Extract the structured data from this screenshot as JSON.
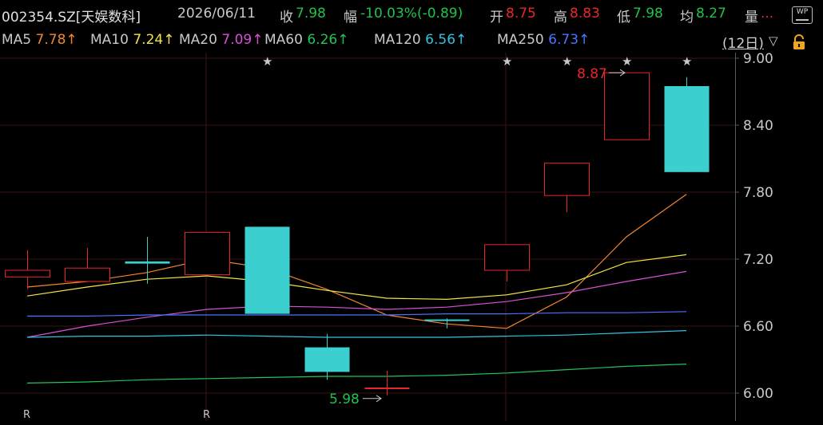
{
  "header": {
    "code": "002354.SZ[天娱数科]",
    "date": "2026/06/11",
    "close_label": "收",
    "close_value": "7.98",
    "change_label": "幅",
    "change_value": "-10.03%(-0.89)",
    "open_label": "开",
    "open_value": "8.75",
    "high_label": "高",
    "high_value": "8.83",
    "low_label": "低",
    "low_value": "7.98",
    "avg_label": "均",
    "avg_value": "8.27",
    "volume_label": "量",
    "volume_value": "..."
  },
  "wp_button": {
    "label": "WP"
  },
  "ma_legend": [
    {
      "label": "MA5",
      "value": "7.78↑",
      "color": "#f2862e"
    },
    {
      "label": "MA10",
      "value": "7.24↑",
      "color": "#f1e545"
    },
    {
      "label": "MA20",
      "value": "7.09↑",
      "color": "#d84fd8"
    },
    {
      "label": "MA60",
      "value": "6.26↑",
      "color": "#22c35a"
    },
    {
      "label": "MA120",
      "value": "6.56↑",
      "color": "#31c3e0"
    },
    {
      "label": "MA250",
      "value": "6.73↑",
      "color": "#4a73ff"
    }
  ],
  "period_label": "(12日)",
  "period_arrow": "▽",
  "icons": {
    "lock": "lock-icon",
    "period_dropdown": "chevron-down-icon"
  },
  "colors": {
    "up": "#e8262b",
    "down": "#3ccfcf",
    "grid": "#3a1616",
    "axis": "#5a5a5a",
    "text": "#c8c8c8"
  },
  "chart_data": {
    "type": "candlestick",
    "y_ticks": [
      "9.00",
      "8.40",
      "7.80",
      "7.20",
      "6.60",
      "6.00"
    ],
    "ylim": [
      5.75,
      9.05
    ],
    "candles": [
      {
        "open": 7.04,
        "close": 7.1,
        "high": 7.28,
        "low": 6.93
      },
      {
        "open": 7.0,
        "close": 7.12,
        "high": 7.3,
        "low": 7.0
      },
      {
        "open": 7.18,
        "close": 7.16,
        "high": 7.4,
        "low": 6.98
      },
      {
        "open": 7.06,
        "close": 7.44,
        "high": 7.44,
        "low": 7.06
      },
      {
        "open": 7.49,
        "close": 6.71,
        "high": 7.49,
        "low": 6.71
      },
      {
        "open": 6.41,
        "close": 6.19,
        "high": 6.53,
        "low": 6.12
      },
      {
        "open": 6.05,
        "close": 6.05,
        "high": 6.2,
        "low": 5.98
      },
      {
        "open": 6.66,
        "close": 6.65,
        "high": 6.67,
        "low": 6.58
      },
      {
        "open": 7.1,
        "close": 7.33,
        "high": 7.33,
        "low": 7.0
      },
      {
        "open": 7.77,
        "close": 8.06,
        "high": 8.06,
        "low": 7.62
      },
      {
        "open": 8.27,
        "close": 8.87,
        "high": 8.87,
        "low": 8.27
      },
      {
        "open": 8.75,
        "close": 7.98,
        "high": 8.83,
        "low": 7.98
      }
    ],
    "ma_lines": [
      {
        "name": "MA5",
        "color": "#f2862e",
        "values": [
          6.95,
          7.0,
          7.08,
          7.2,
          7.12,
          6.93,
          6.7,
          6.62,
          6.58,
          6.86,
          7.4,
          7.78
        ]
      },
      {
        "name": "MA10",
        "color": "#f1e545",
        "values": [
          6.87,
          6.95,
          7.02,
          7.05,
          7.0,
          6.92,
          6.85,
          6.84,
          6.88,
          6.97,
          7.17,
          7.24
        ]
      },
      {
        "name": "MA20",
        "color": "#d84fd8",
        "values": [
          6.5,
          6.6,
          6.68,
          6.75,
          6.78,
          6.77,
          6.75,
          6.77,
          6.82,
          6.9,
          7.0,
          7.09
        ]
      },
      {
        "name": "MA60",
        "color": "#22c35a",
        "values": [
          6.09,
          6.1,
          6.12,
          6.13,
          6.14,
          6.15,
          6.15,
          6.16,
          6.18,
          6.21,
          6.24,
          6.26
        ]
      },
      {
        "name": "MA120",
        "color": "#31c3e0",
        "values": [
          6.5,
          6.51,
          6.51,
          6.52,
          6.51,
          6.5,
          6.5,
          6.5,
          6.51,
          6.52,
          6.54,
          6.56
        ]
      },
      {
        "name": "MA250",
        "color": "#4a73ff",
        "values": [
          6.69,
          6.69,
          6.7,
          6.7,
          6.7,
          6.7,
          6.7,
          6.71,
          6.71,
          6.72,
          6.72,
          6.73
        ]
      }
    ],
    "star_markers": [
      4,
      8,
      9,
      10,
      11
    ],
    "r_markers": [
      0,
      3
    ],
    "max_annotation": {
      "text": "8.87",
      "index": 10,
      "value": 8.87
    },
    "min_annotation": {
      "text": "5.98",
      "index": 6,
      "value": 5.98
    }
  }
}
